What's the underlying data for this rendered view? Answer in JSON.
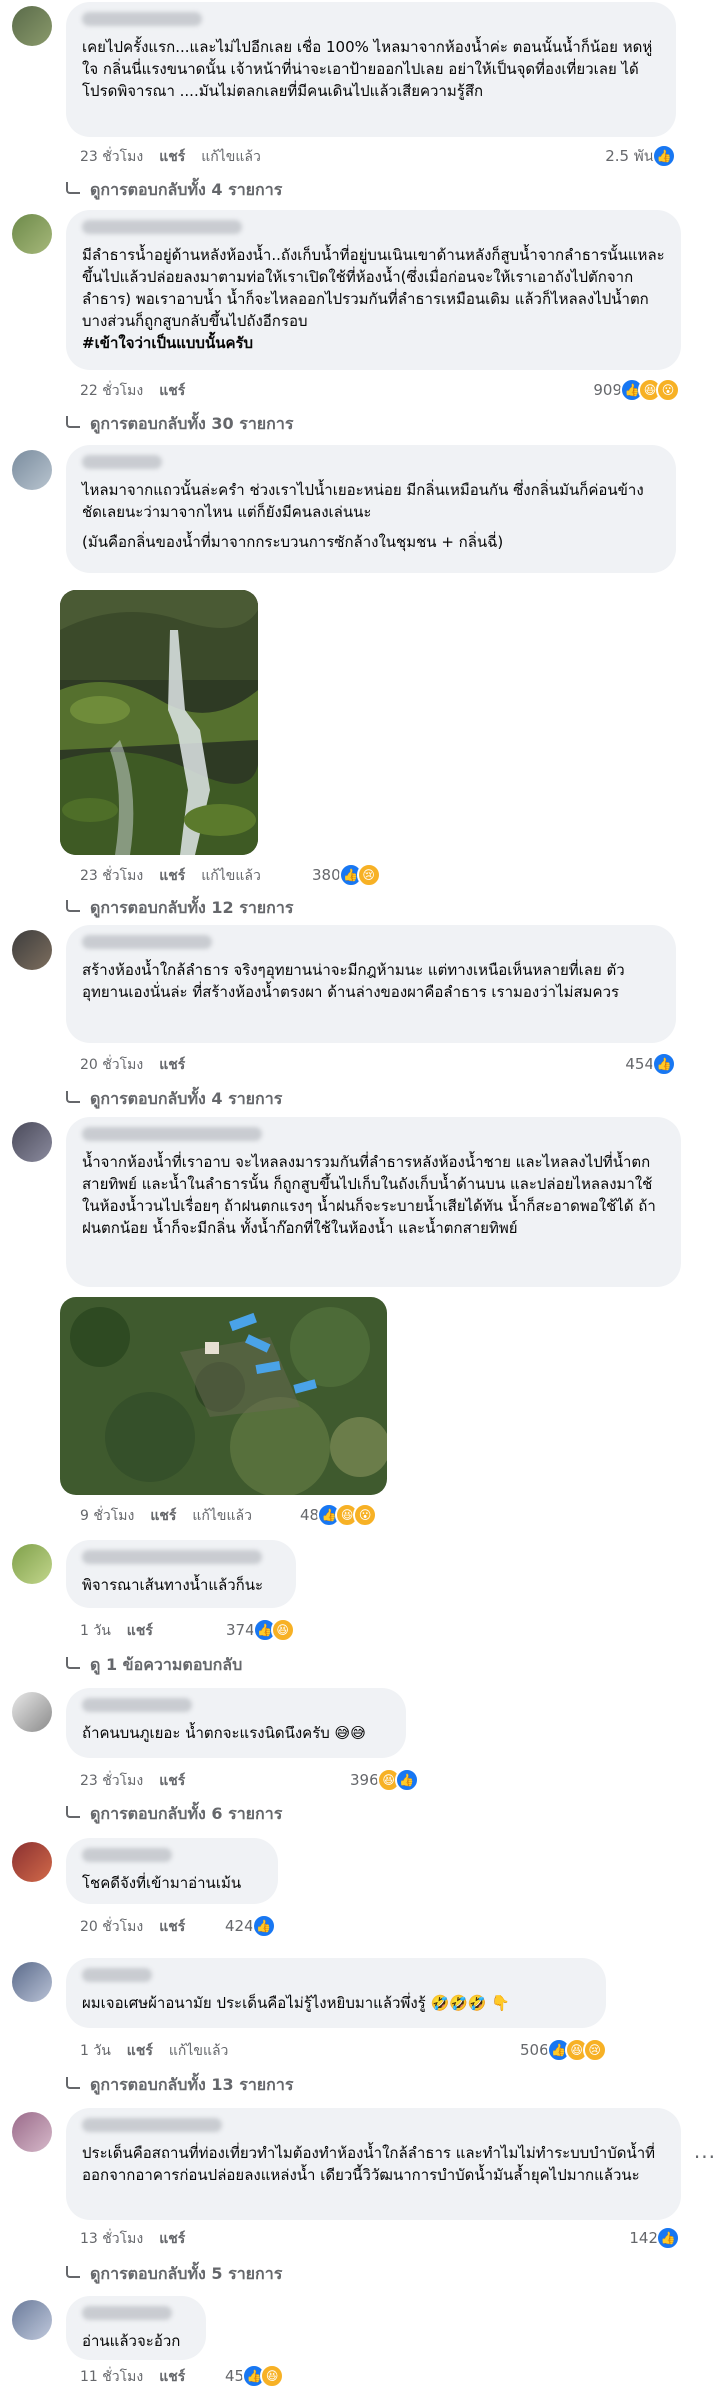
{
  "actions": {
    "reply": "แชร์",
    "edit": "แก้ไขแล้ว"
  },
  "comments": [
    {
      "text": "เคยไปครั้งแรก...และไม่ไปอีกเลย เชื่อ 100% ไหลมาจากห้องน้ำค่ะ ตอนนั้นน้ำก็น้อย หดหู่ใจ กลิ่นนี่แรงขนาดนั้น เจ้าหน้าที่น่าจะเอาป้ายออกไปเลย อย่าให้เป็นจุดที่องเที่ยวเลย ได้โปรดพิจารณา ....มันไม่ตลกเลยที่มีคนเดินไปแล้วเสียความรู้สึก",
      "time": "23 ชั่วโมง",
      "edited": true,
      "reaction_count": "2.5 พัน",
      "reactions": [
        "like"
      ],
      "replies": "ดูการตอบกลับทั้ง 4 รายการ"
    },
    {
      "text": "มีลำธารน้ำอยู่ด้านหลังห้องน้ำ..ถังเก็บน้ำที่อยู่บนเนินเขาด้านหลังก็สูบน้ำจากลำธารนั้นแหละขึ้นไปแล้วปล่อยลงมาตามท่อให้เราเปิดใช้ที่ห้องน้ำ(ซึ่งเมื่อก่อนจะให้เราเอาถังไปตักจากลำธาร) พอเราอาบน้ำ น้ำก็จะไหลออกไปรวมกันที่ลำธารเหมือนเดิม แล้วก็ไหลลงไปน้ำตก บางส่วนก็ถูกสูบกลับขึ้นไปถังอีกรอบ",
      "hashtag": "#เข้าใจว่าเป็นแบบนั้นครับ",
      "time": "22 ชั่วโมง",
      "edited": false,
      "reaction_count": "909",
      "reactions": [
        "like",
        "haha",
        "wow"
      ],
      "replies": "ดูการตอบกลับทั้ง 30 รายการ"
    },
    {
      "text": "ไหลมาจากแถวนั้นล่ะครำ ช่วงเราไปน้ำเยอะหน่อย มีกลิ่นเหมือนกัน ซึ่งกลิ่นมันก็ค่อนข้างชัดเลยนะว่ามาจากไหน แต่ก็ยังมีคนลงเล่นนะ",
      "text2": "(มันคือกลิ่นของน้ำที่มาจากกระบวนการซักล้างในชุมชน + กลิ่นฉี่)",
      "time": "23 ชั่วโมง",
      "edited": true,
      "reaction_count": "380",
      "reactions": [
        "like",
        "sad"
      ],
      "replies": "ดูการตอบกลับทั้ง 12 รายการ"
    },
    {
      "text": "สร้างห้องน้ำใกล้ลำธาร จริงๆอุทยานน่าจะมีกฎห้ามนะ แต่ทางเหนือเห็นหลายที่เลย ตัวอุทยานเองนั่นล่ะ ที่สร้างห้องน้ำตรงผา ด้านล่างของผาคือลำธาร เรามองว่าไม่สมควร",
      "time": "20 ชั่วโมง",
      "edited": false,
      "reaction_count": "454",
      "reactions": [
        "like"
      ],
      "replies": "ดูการตอบกลับทั้ง 4 รายการ"
    },
    {
      "text": "น้ำจากห้องน้ำที่เราอาบ จะไหลลงมารวมกันที่ลำธารหลังห้องน้ำชาย และไหลลงไปที่น้ำตกสายทิพย์ และน้ำในลำธารนั้น ก็ถูกสูบขึ้นไปเก็บในถังเก็บน้ำด้านบน และปล่อยไหลลงมาใช้ในห้องน้ำวนไปเรื่อยๆ ถ้าฝนตกแรงๆ น้ำฝนก็จะระบายน้ำเสียได้ทัน น้ำก็สะอาดพอใช้ได้ ถ้าฝนตกน้อย น้ำก็จะมีกลิ่น ทั้งน้ำก๊อกที่ใช้ในห้องน้ำ และน้ำตกสายทิพย์",
      "time": "9 ชั่วโมง",
      "edited": true,
      "reaction_count": "48",
      "reactions": [
        "like",
        "haha",
        "wow"
      ],
      "replies": ""
    },
    {
      "text": "พิจารณาเส้นทางน้ำแล้วก็นะ",
      "time": "1 วัน",
      "edited": false,
      "reaction_count": "374",
      "reactions": [
        "like",
        "haha"
      ],
      "replies": "ดู 1 ข้อความตอบกลับ"
    },
    {
      "text": "ถ้าคนบนภูเยอะ น้ำตกจะแรงนิดนึงครับ 😅😅",
      "time": "23 ชั่วโมง",
      "edited": false,
      "reaction_count": "396",
      "reactions": [
        "haha",
        "like"
      ],
      "replies": "ดูการตอบกลับทั้ง 6 รายการ"
    },
    {
      "text": "โชคดีจังที่เข้ามาอ่านเม้น",
      "time": "20 ชั่วโมง",
      "edited": false,
      "reaction_count": "424",
      "reactions": [
        "like"
      ],
      "replies": ""
    },
    {
      "text": "ผมเจอเศษผ้าอนามัย ประเด็นคือไม่รู้ไงหยิบมาแล้วพึ่งรู้ 🤣🤣🤣 👇",
      "time": "1 วัน",
      "edited": true,
      "reaction_count": "506",
      "reactions": [
        "like",
        "haha",
        "sad"
      ],
      "replies": "ดูการตอบกลับทั้ง 13 รายการ"
    },
    {
      "text": "ประเด็นคือสถานที่ท่องเที่ยวทำไมต้องทำห้องน้ำใกล้ลำธาร และทำไมไม่ทำระบบบำบัดน้ำที่ออกจากอาคารก่อนปล่อยลงแหล่งน้ำ เดียวนี้วิวัฒนาการบำบัดน้ำมันล้ำยุคไปมากแล้วนะ",
      "time": "13 ชั่วโมง",
      "edited": false,
      "reaction_count": "142",
      "reactions": [
        "like"
      ],
      "replies": "ดูการตอบกลับทั้ง 5 รายการ"
    },
    {
      "text": "อ่านแล้วจะอ้วก",
      "time": "11 ชั่วโมง",
      "edited": false,
      "reaction_count": "45",
      "reactions": [
        "like",
        "haha"
      ],
      "replies": ""
    }
  ]
}
